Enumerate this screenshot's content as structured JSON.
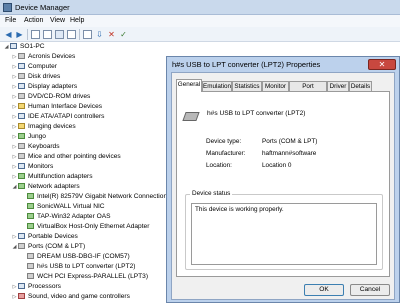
{
  "main_window": {
    "title": "Device Manager",
    "menu": [
      "File",
      "Action",
      "View",
      "Help"
    ]
  },
  "tree": {
    "root": "SO1-PC",
    "categories": [
      {
        "label": "Acronis Devices",
        "expanded": false
      },
      {
        "label": "Computer",
        "expanded": false
      },
      {
        "label": "Disk drives",
        "expanded": false
      },
      {
        "label": "Display adapters",
        "expanded": false
      },
      {
        "label": "DVD/CD-ROM drives",
        "expanded": false
      },
      {
        "label": "Human Interface Devices",
        "expanded": false
      },
      {
        "label": "IDE ATA/ATAPI controllers",
        "expanded": false
      },
      {
        "label": "Imaging devices",
        "expanded": false
      },
      {
        "label": "Jungo",
        "expanded": false
      },
      {
        "label": "Keyboards",
        "expanded": false
      },
      {
        "label": "Mice and other pointing devices",
        "expanded": false
      },
      {
        "label": "Monitors",
        "expanded": false
      },
      {
        "label": "Multifunction adapters",
        "expanded": false
      },
      {
        "label": "Network adapters",
        "expanded": true
      },
      {
        "label": "Portable Devices",
        "expanded": false
      },
      {
        "label": "Ports (COM & LPT)",
        "expanded": true
      },
      {
        "label": "Processors",
        "expanded": false
      },
      {
        "label": "Sound, video and game controllers",
        "expanded": false
      }
    ],
    "network_adapters": [
      "Intel(R) 82579V Gigabit Network Connection",
      "SonicWALL Virtual NIC",
      "TAP-Win32 Adapter OAS",
      "VirtualBox Host-Only Ethernet Adapter"
    ],
    "ports": [
      "DREAM USB-DBG-IF (COM57)",
      "h#s USB to LPT converter (LPT2)",
      "WCH PCI Express-PARALLEL (LPT3)"
    ]
  },
  "dialog": {
    "title": "h#s USB to LPT converter (LPT2) Properties",
    "close_glyph": "✕",
    "tabs": [
      "General",
      "Emulation",
      "Statistics",
      "Monitor",
      "Port Settings",
      "Driver",
      "Details"
    ],
    "active_tab": "General",
    "device_name": "h#s USB to LPT converter (LPT2)",
    "properties": [
      {
        "key": "Device type:",
        "value": "Ports (COM & LPT)"
      },
      {
        "key": "Manufacturer:",
        "value": "haftmann#software"
      },
      {
        "key": "Location:",
        "value": "Location 0"
      }
    ],
    "status_group_label": "Device status",
    "status_text": "This device is working properly.",
    "buttons": {
      "ok": "OK",
      "cancel": "Cancel"
    }
  }
}
